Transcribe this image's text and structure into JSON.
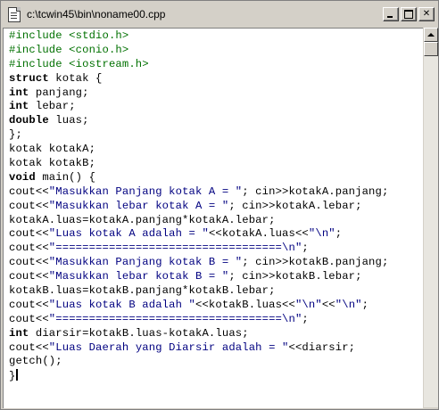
{
  "window": {
    "title": "c:\\tcwin45\\bin\\noname00.cpp",
    "buttons": {
      "minimize": "",
      "maximize": "",
      "close": "✕"
    }
  },
  "editor": {
    "lines": [
      [
        {
          "t": "#include <stdio.h>",
          "c": "pp"
        }
      ],
      [
        {
          "t": "#include <conio.h>",
          "c": "pp"
        }
      ],
      [
        {
          "t": "#include <iostream.h>",
          "c": "pp"
        }
      ],
      [
        {
          "t": "struct",
          "c": "kw"
        },
        {
          "t": " kotak {",
          "c": ""
        }
      ],
      [
        {
          "t": "int",
          "c": "kw"
        },
        {
          "t": " panjang;",
          "c": ""
        }
      ],
      [
        {
          "t": "int",
          "c": "kw"
        },
        {
          "t": " lebar;",
          "c": ""
        }
      ],
      [
        {
          "t": "double",
          "c": "kw"
        },
        {
          "t": " luas;",
          "c": ""
        }
      ],
      [
        {
          "t": "};",
          "c": ""
        }
      ],
      [
        {
          "t": "kotak kotakA;",
          "c": ""
        }
      ],
      [
        {
          "t": "kotak kotakB;",
          "c": ""
        }
      ],
      [
        {
          "t": "void",
          "c": "kw"
        },
        {
          "t": " main() {",
          "c": ""
        }
      ],
      [
        {
          "t": "cout<<",
          "c": ""
        },
        {
          "t": "\"Masukkan Panjang kotak A = \"",
          "c": "str"
        },
        {
          "t": "; cin>>kotakA.panjang;",
          "c": ""
        }
      ],
      [
        {
          "t": "cout<<",
          "c": ""
        },
        {
          "t": "\"Masukkan lebar kotak A = \"",
          "c": "str"
        },
        {
          "t": "; cin>>kotakA.lebar;",
          "c": ""
        }
      ],
      [
        {
          "t": "kotakA.luas=kotakA.panjang*kotakA.lebar;",
          "c": ""
        }
      ],
      [
        {
          "t": "cout<<",
          "c": ""
        },
        {
          "t": "\"Luas kotak A adalah = \"",
          "c": "str"
        },
        {
          "t": "<<kotakA.luas<<",
          "c": ""
        },
        {
          "t": "\"\\n\"",
          "c": "str"
        },
        {
          "t": ";",
          "c": ""
        }
      ],
      [
        {
          "t": "cout<<",
          "c": ""
        },
        {
          "t": "\"==================================\\n\"",
          "c": "str"
        },
        {
          "t": ";",
          "c": ""
        }
      ],
      [
        {
          "t": "cout<<",
          "c": ""
        },
        {
          "t": "\"Masukkan Panjang kotak B = \"",
          "c": "str"
        },
        {
          "t": "; cin>>kotakB.panjang;",
          "c": ""
        }
      ],
      [
        {
          "t": "cout<<",
          "c": ""
        },
        {
          "t": "\"Masukkan lebar kotak B = \"",
          "c": "str"
        },
        {
          "t": "; cin>>kotakB.lebar;",
          "c": ""
        }
      ],
      [
        {
          "t": "kotakB.luas=kotakB.panjang*kotakB.lebar;",
          "c": ""
        }
      ],
      [
        {
          "t": "cout<<",
          "c": ""
        },
        {
          "t": "\"Luas kotak B adalah \"",
          "c": "str"
        },
        {
          "t": "<<kotakB.luas<<",
          "c": ""
        },
        {
          "t": "\"\\n\"",
          "c": "str"
        },
        {
          "t": "<<",
          "c": ""
        },
        {
          "t": "\"\\n\"",
          "c": "str"
        },
        {
          "t": ";",
          "c": ""
        }
      ],
      [
        {
          "t": "cout<<",
          "c": ""
        },
        {
          "t": "\"==================================\\n\"",
          "c": "str"
        },
        {
          "t": ";",
          "c": ""
        }
      ],
      [
        {
          "t": "int",
          "c": "kw"
        },
        {
          "t": " diarsir=kotakB.luas-kotakA.luas;",
          "c": ""
        }
      ],
      [
        {
          "t": "cout<<",
          "c": ""
        },
        {
          "t": "\"Luas Daerah yang Diarsir adalah = \"",
          "c": "str"
        },
        {
          "t": "<<diarsir;",
          "c": ""
        }
      ],
      [
        {
          "t": "getch();",
          "c": ""
        }
      ],
      [
        {
          "t": "}",
          "c": ""
        }
      ]
    ]
  }
}
